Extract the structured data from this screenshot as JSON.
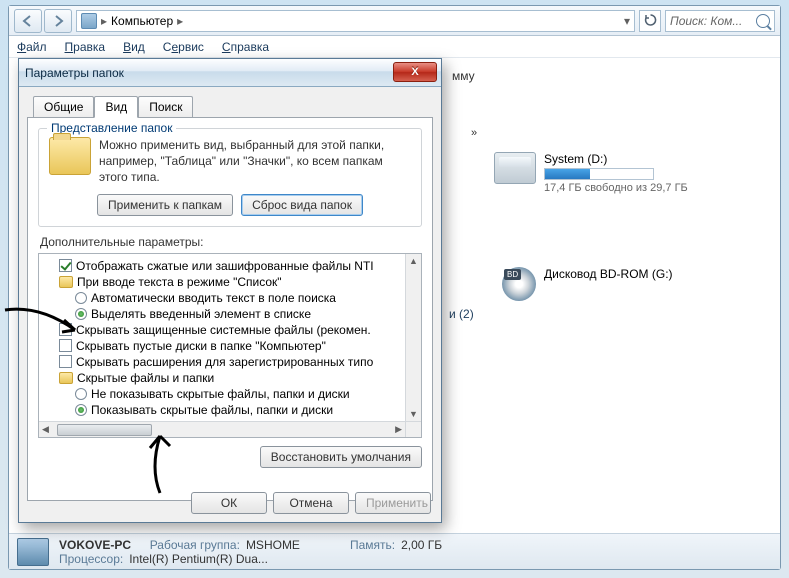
{
  "addressbar": {
    "location": "Компьютер"
  },
  "search": {
    "placeholder": "Поиск: Ком..."
  },
  "menu": {
    "file": "Файл",
    "edit": "Правка",
    "view": "Вид",
    "service": "Сервис",
    "help": "Справка"
  },
  "content_more": "»",
  "drives_group_partial": "и (2)",
  "drive_d": {
    "name": "System (D:)",
    "free": "17,4 ГБ свободно из 29,7 ГБ",
    "used_pct": 42
  },
  "drive_g": {
    "name": "Дисковод BD-ROM (G:)"
  },
  "status": {
    "comp": "VOKOVE-PC",
    "workgroup_lbl": "Рабочая группа:",
    "workgroup": "MSHOME",
    "cpu_lbl": "Процессор:",
    "cpu": "Intel(R) Pentium(R) Dua...",
    "mem_lbl": "Память:",
    "mem": "2,00 ГБ"
  },
  "mmu_hidden": "мму",
  "dialog": {
    "title": "Параметры папок",
    "tabs": {
      "general": "Общие",
      "view": "Вид",
      "search": "Поиск"
    },
    "groupbox": {
      "title": "Представление папок",
      "text": "Можно применить вид, выбранный для этой папки, например, \"Таблица\" или \"Значки\", ко всем папкам этого типа.",
      "apply_btn": "Применить к папкам",
      "reset_btn": "Сброс вида папок"
    },
    "adv_label": "Дополнительные параметры:",
    "opts": {
      "o1": "Отображать сжатые или зашифрованные файлы NTI",
      "o2": "При вводе текста в режиме \"Список\"",
      "o2a": "Автоматически вводить текст в поле поиска",
      "o2b": "Выделять введенный элемент в списке",
      "o3": "Скрывать защищенные системные файлы (рекомен.",
      "o4": "Скрывать пустые диски в папке \"Компьютер\"",
      "o5": "Скрывать расширения для зарегистрированных типо",
      "o6": "Скрытые файлы и папки",
      "o6a": "Не показывать скрытые файлы, папки и диски",
      "o6b": "Показывать скрытые файлы, папки и диски"
    },
    "restore": "Восстановить умолчания",
    "ok": "ОК",
    "cancel": "Отмена",
    "apply": "Применить"
  }
}
